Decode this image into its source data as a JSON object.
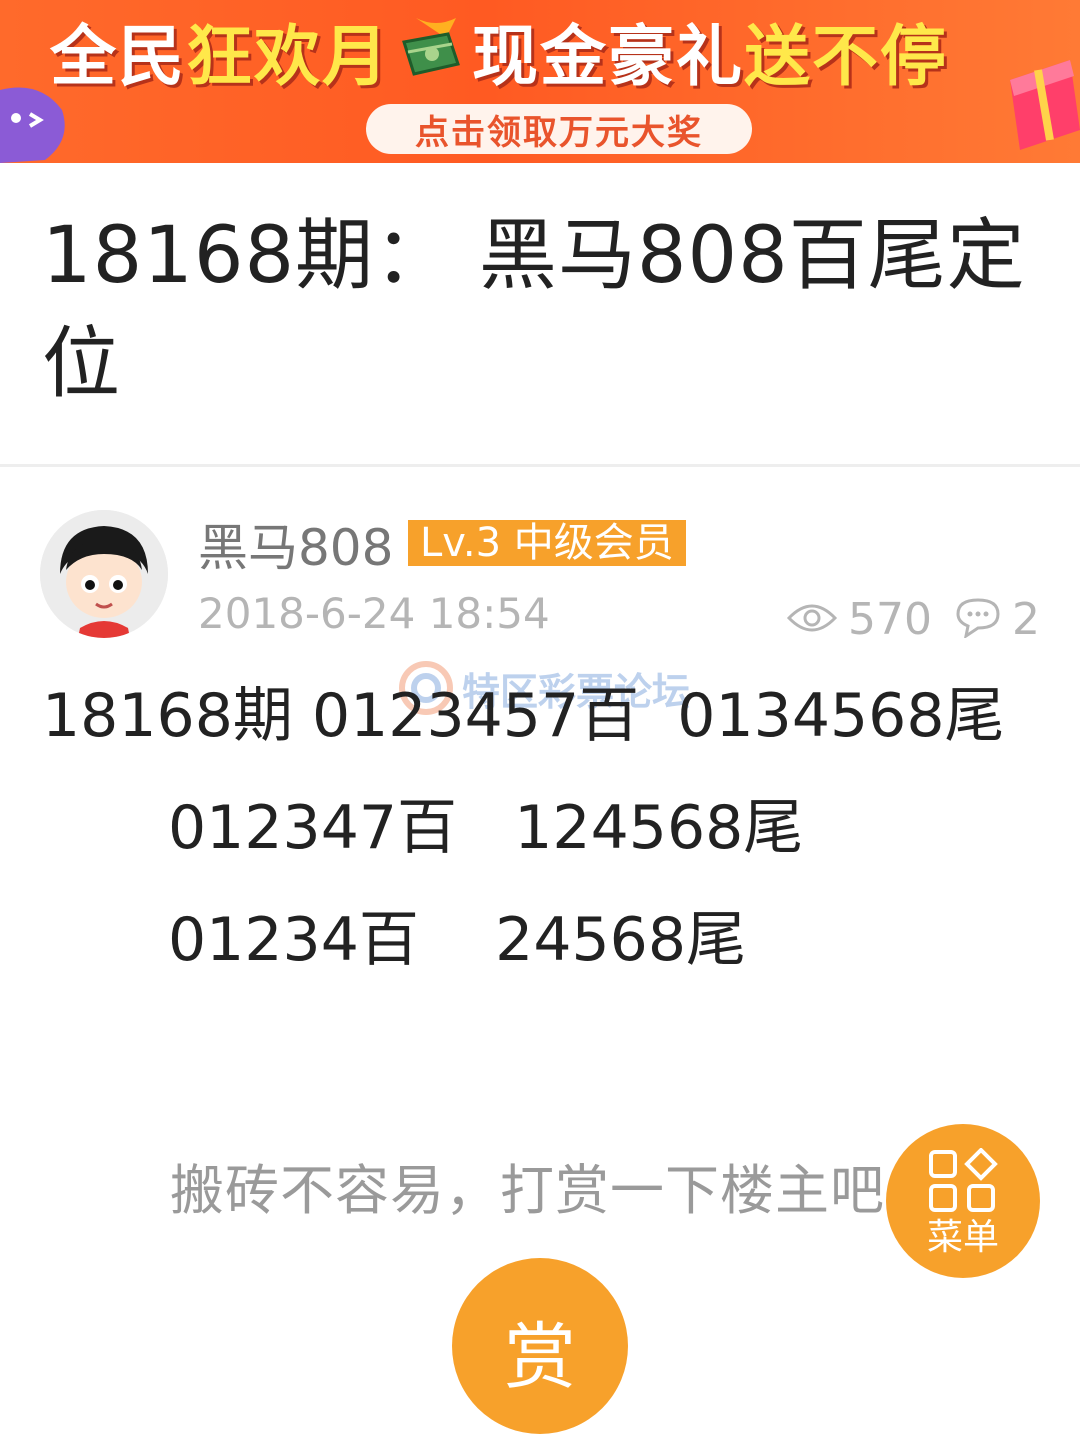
{
  "banner": {
    "title_part1": "全民",
    "title_part2": "狂欢月",
    "title_part3": "现金豪礼",
    "title_part4": "送不停",
    "button_label": "点击领取万元大奖"
  },
  "post": {
    "title": "18168期： 黑马808百尾定位",
    "author": {
      "name": "黑马808",
      "level_badge": "Lv.3 中级会员"
    },
    "time": "2018-6-24 18:54",
    "views": "570",
    "comments": "2",
    "content_lines": [
      "18168期 0123457百  0134568尾",
      "012347百   124568尾",
      "01234百    24568尾"
    ],
    "watermark": "特区彩票论坛"
  },
  "reward": {
    "prompt": "搬砖不容易，打赏一下楼主吧",
    "button_label": "赏"
  },
  "menu": {
    "label": "菜单"
  },
  "colors": {
    "banner": "#ff5a22",
    "accent": "#f7a12b"
  }
}
